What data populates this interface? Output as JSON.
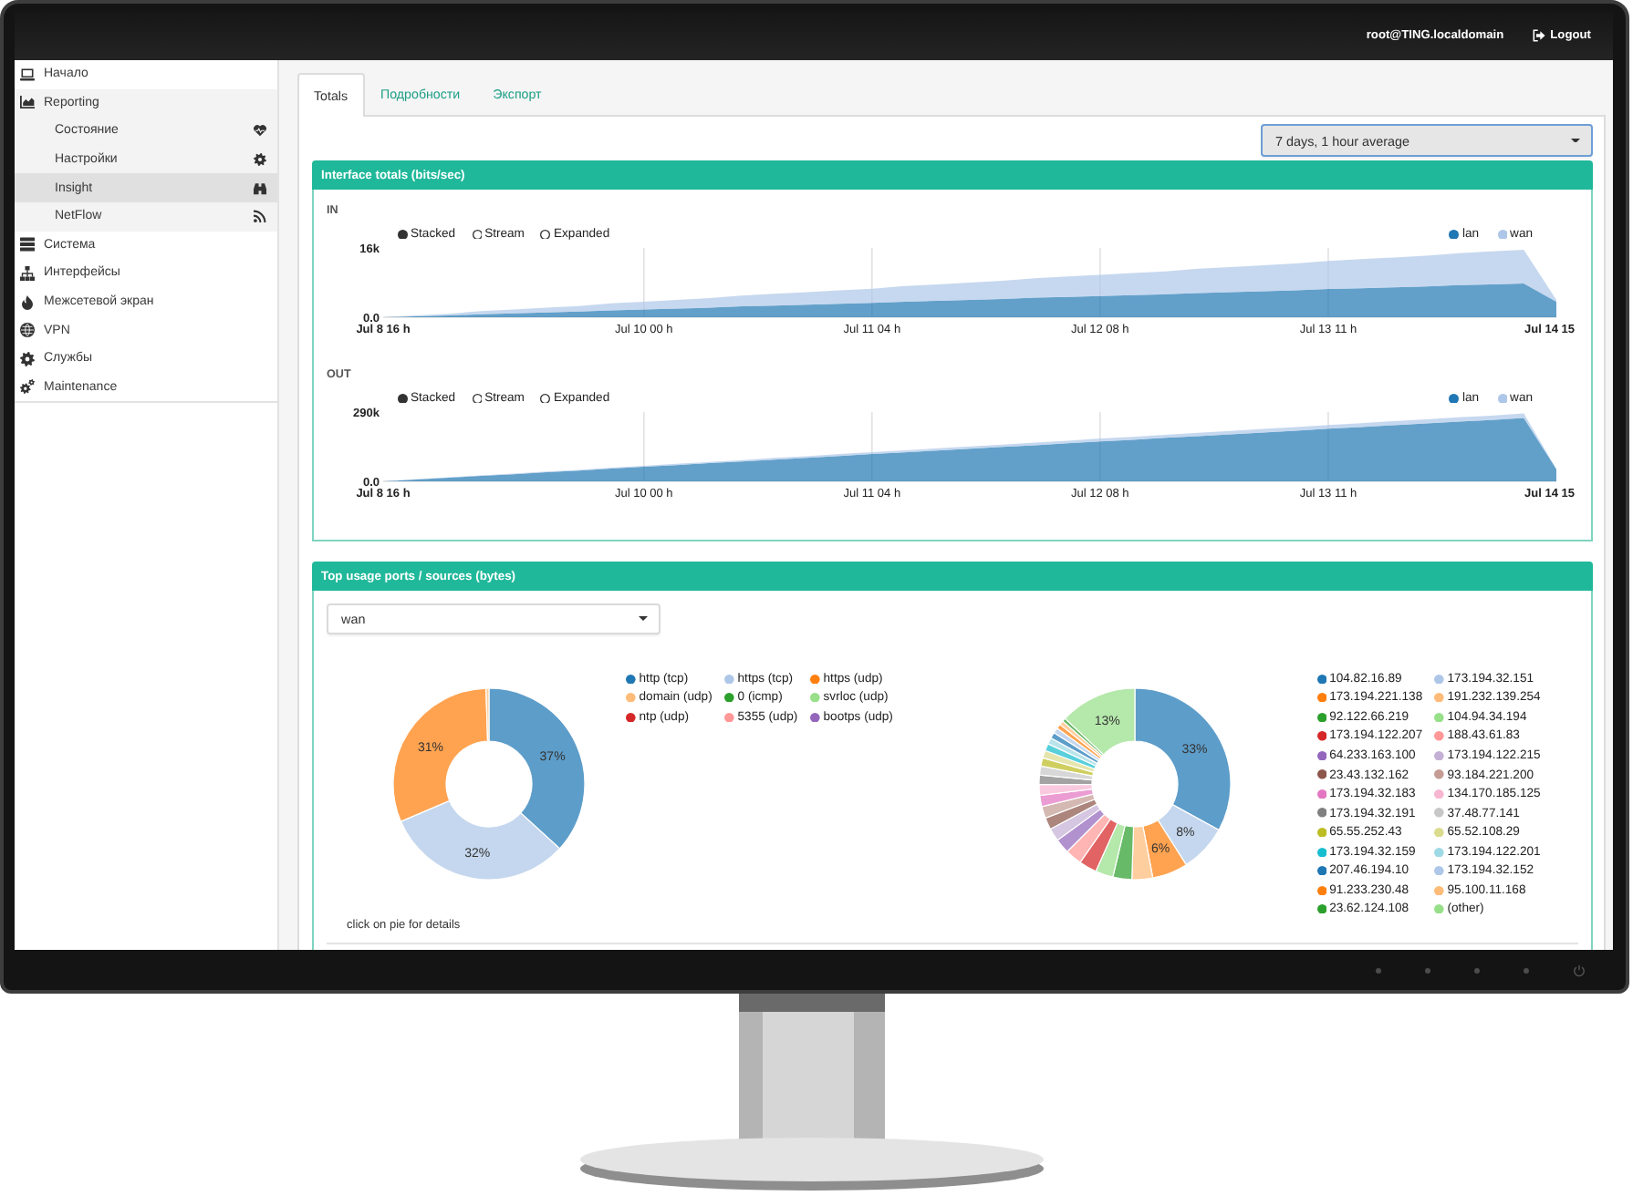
{
  "header": {
    "user": "root@TING.localdomain",
    "logout": "Logout"
  },
  "sidebar": {
    "items": [
      {
        "label": "Начало",
        "selected": false
      },
      {
        "label": "Reporting",
        "selected": false,
        "children": [
          {
            "label": "Состояние",
            "selected": false
          },
          {
            "label": "Настройки",
            "selected": false
          },
          {
            "label": "Insight",
            "selected": true
          },
          {
            "label": "NetFlow",
            "selected": false
          }
        ]
      },
      {
        "label": "Система",
        "selected": false
      },
      {
        "label": "Интерфейсы",
        "selected": false
      },
      {
        "label": "Межсетевой экран",
        "selected": false
      },
      {
        "label": "VPN",
        "selected": false
      },
      {
        "label": "Службы",
        "selected": false
      },
      {
        "label": "Maintenance",
        "selected": false
      }
    ]
  },
  "tabs": [
    {
      "label": "Totals",
      "selected": true
    },
    {
      "label": "Подробности",
      "selected": false
    },
    {
      "label": "Экспорт",
      "selected": false
    }
  ],
  "period_select": {
    "value": "7 days, 1 hour average",
    "focused": true
  },
  "panels": [
    {
      "title": "Interface totals (bits/sec)",
      "charts": [
        {
          "modes": [
            {
              "label": "Stacked",
              "selected": true
            },
            {
              "label": "Stream",
              "selected": false
            },
            {
              "label": "Expanded",
              "selected": false
            }
          ],
          "chart_data": {
            "type": "area",
            "title": "IN",
            "stacked": true,
            "grid": true,
            "categories": [
              "Jul 8 16 h",
              null,
              null,
              null,
              null,
              null,
              null,
              null,
              "Jul 10 00 h",
              null,
              null,
              null,
              null,
              null,
              null,
              "Jul 11 04 h",
              null,
              null,
              null,
              null,
              null,
              null,
              "Jul 12 08 h",
              null,
              null,
              null,
              null,
              null,
              null,
              "Jul 13 11 h",
              null,
              null,
              null,
              null,
              null,
              null,
              "Jul 14 15"
            ],
            "ylim": [
              0,
              16000
            ],
            "yticks": [
              {
                "value": 0,
                "label": "0.0"
              },
              {
                "value": 16000,
                "label": "16k"
              }
            ],
            "series": [
              {
                "name": "lan",
                "color": "#1f77b4",
                "values": [
                  0,
                  200,
                  400,
                  700,
                  900,
                  1100,
                  1300,
                  1600,
                  1800,
                  2000,
                  2200,
                  2500,
                  2700,
                  2900,
                  3100,
                  3300,
                  3600,
                  3800,
                  4000,
                  4200,
                  4500,
                  4700,
                  4900,
                  5100,
                  5300,
                  5600,
                  5800,
                  6000,
                  6200,
                  6500,
                  6700,
                  6900,
                  7100,
                  7400,
                  7600,
                  7800,
                  3600
                ]
              },
              {
                "name": "wan",
                "color": "#aec7e8",
                "values": [
                  0,
                  200,
                  400,
                  700,
                  900,
                  1100,
                  1300,
                  1600,
                  1800,
                  2000,
                  2200,
                  2500,
                  2700,
                  2900,
                  3100,
                  3300,
                  3600,
                  3800,
                  4000,
                  4200,
                  4500,
                  4700,
                  4900,
                  5100,
                  5300,
                  5600,
                  5800,
                  6000,
                  6200,
                  6500,
                  6700,
                  6900,
                  7100,
                  7400,
                  7600,
                  7800,
                  400
                ]
              }
            ]
          }
        },
        {
          "modes": [
            {
              "label": "Stacked",
              "selected": true
            },
            {
              "label": "Stream",
              "selected": false
            },
            {
              "label": "Expanded",
              "selected": false
            }
          ],
          "chart_data": {
            "type": "area",
            "title": "OUT",
            "stacked": true,
            "grid": true,
            "categories": [
              "Jul 8 16 h",
              null,
              null,
              null,
              null,
              null,
              null,
              null,
              "Jul 10 00 h",
              null,
              null,
              null,
              null,
              null,
              null,
              "Jul 11 04 h",
              null,
              null,
              null,
              null,
              null,
              null,
              "Jul 12 08 h",
              null,
              null,
              null,
              null,
              null,
              null,
              "Jul 13 11 h",
              null,
              null,
              null,
              null,
              null,
              null,
              "Jul 14 15"
            ],
            "ylim": [
              0,
              290000
            ],
            "yticks": [
              {
                "value": 0,
                "label": "0.0"
              },
              {
                "value": 290000,
                "label": "290k"
              }
            ],
            "series": [
              {
                "name": "lan",
                "color": "#1f77b4",
                "values": [
                  0,
                  8000,
                  15000,
                  23000,
                  30000,
                  38000,
                  45000,
                  53000,
                  61000,
                  68000,
                  76000,
                  83000,
                  91000,
                  98000,
                  106000,
                  114000,
                  121000,
                  129000,
                  136000,
                  144000,
                  151000,
                  159000,
                  167000,
                  174000,
                  182000,
                  189000,
                  197000,
                  204000,
                  212000,
                  220000,
                  227000,
                  235000,
                  242000,
                  250000,
                  257000,
                  265000,
                  51000
                ]
              },
              {
                "name": "wan",
                "color": "#aec7e8",
                "values": [
                  0,
                  1000,
                  1000,
                  2000,
                  2000,
                  3000,
                  3000,
                  4000,
                  4000,
                  5000,
                  5000,
                  6000,
                  7000,
                  7000,
                  8000,
                  8000,
                  9000,
                  9000,
                  10000,
                  10000,
                  11000,
                  11000,
                  12000,
                  12000,
                  13000,
                  14000,
                  14000,
                  15000,
                  15000,
                  16000,
                  16000,
                  17000,
                  17000,
                  18000,
                  18000,
                  19000,
                  1000
                ]
              }
            ]
          }
        }
      ]
    },
    {
      "title": "Top usage ports / sources (bytes)",
      "select": {
        "value": "wan",
        "focused": false
      },
      "charts": [
        {
          "chart_data": {
            "type": "donut",
            "categories": [
              "http (tcp)",
              "https (tcp)",
              "https (udp)",
              "domain (udp)",
              "0 (icmp)",
              "svrloc (udp)",
              "ntp (udp)",
              "5355 (udp)",
              "bootps (udp)"
            ],
            "colors": [
              "#1f77b4",
              "#aec7e8",
              "#ff7f0e",
              "#ffbb78",
              "#2ca02c",
              "#98df8a",
              "#d62728",
              "#ff9896",
              "#9467bd"
            ],
            "values": [
              36.8,
              31.8,
              30.9,
              0.5,
              null,
              null,
              null,
              null,
              null
            ],
            "value_labels": [
              "37%",
              "32%",
              "31%",
              null,
              null,
              null,
              null,
              null,
              null
            ]
          }
        },
        {
          "chart_data": {
            "type": "donut",
            "categories": [
              "104.82.16.89",
              "173.194.32.151",
              "173.194.221.138",
              "191.232.139.254",
              "92.122.66.219",
              "104.94.34.194",
              "173.194.122.207",
              "188.43.61.83",
              "64.233.163.100",
              "173.194.122.215",
              "23.43.132.162",
              "93.184.221.200",
              "173.194.32.183",
              "134.170.185.125",
              "173.194.32.191",
              "37.48.77.141",
              "65.55.252.43",
              "65.52.108.29",
              "173.194.32.159",
              "173.194.122.201",
              "207.46.194.10",
              "173.194.32.152",
              "91.233.230.48",
              "95.100.11.168",
              "23.62.124.108",
              "(other)"
            ],
            "colors": [
              "#1f77b4",
              "#aec7e8",
              "#ff7f0e",
              "#ffbb78",
              "#2ca02c",
              "#98df8a",
              "#d62728",
              "#ff9896",
              "#9467bd",
              "#c5b0d5",
              "#8c564b",
              "#c49c94",
              "#e377c2",
              "#f7b6d2",
              "#7f7f7f",
              "#c7c7c7",
              "#bcbd22",
              "#dbdb8d",
              "#17becf",
              "#9edae5",
              "#1f77b4",
              "#aec7e8",
              "#ff7f0e",
              "#ffbb78",
              "#2ca02c",
              "#98df8a"
            ],
            "values": [
              33,
              8,
              6,
              3.5,
              3.2,
              3,
              3,
              2.8,
              2.5,
              2.2,
              2,
              2,
              1.9,
              1.8,
              1.6,
              1.5,
              1.4,
              1.3,
              1.2,
              1.1,
              1,
              0.9,
              0.8,
              0.7,
              0.6,
              13
            ],
            "value_labels": [
              "33%",
              "8%",
              "6%",
              null,
              null,
              null,
              null,
              null,
              null,
              null,
              null,
              null,
              null,
              null,
              null,
              null,
              null,
              null,
              null,
              null,
              null,
              null,
              null,
              null,
              null,
              "13%"
            ]
          }
        }
      ],
      "hint": "click on pie for details"
    }
  ]
}
